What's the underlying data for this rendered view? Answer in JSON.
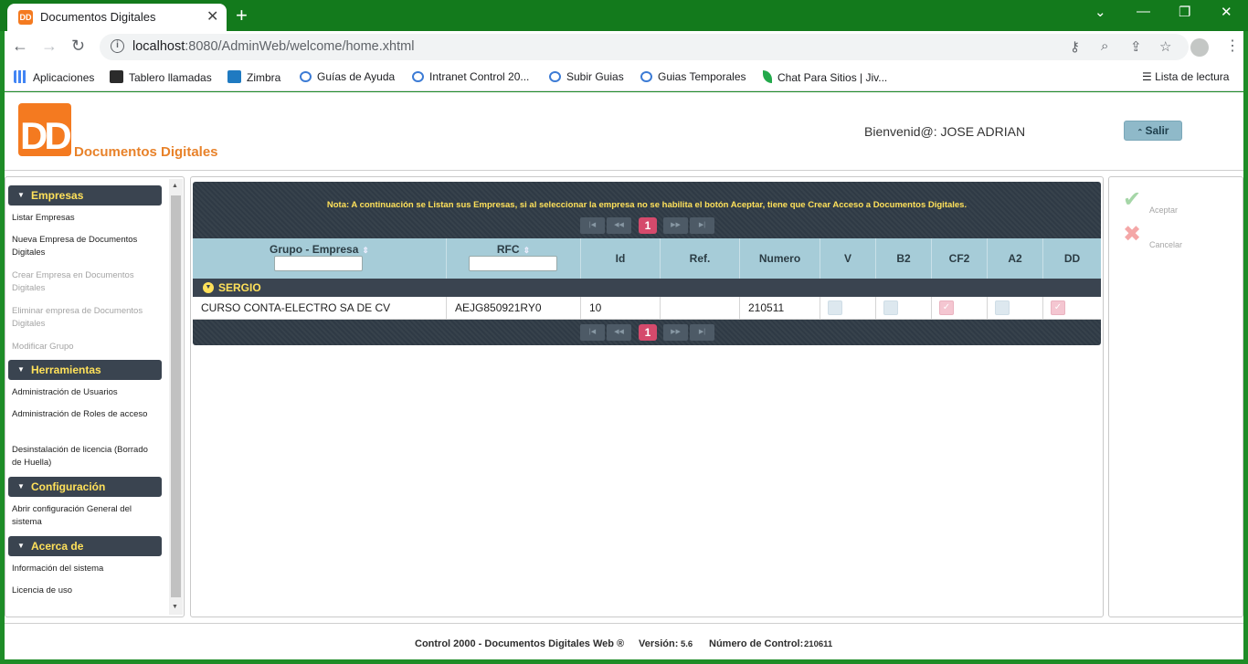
{
  "browser": {
    "tab_title": "Documentos Digitales",
    "tab_favicon": "DD",
    "url_host": "localhost",
    "url_path": ":8080/AdminWeb/welcome/home.xhtml",
    "bookmarks": [
      {
        "label": "Aplicaciones",
        "icon": "apps-grid-icon",
        "color": "#4285f4"
      },
      {
        "label": "Tablero llamadas",
        "icon": "phone-board-icon",
        "color": "#2b2b2b"
      },
      {
        "label": "Zimbra",
        "icon": "zimbra-icon",
        "color": "#1f7ac1"
      },
      {
        "label": "Guías de Ayuda",
        "icon": "co-icon",
        "color": "#3c7bd5"
      },
      {
        "label": "Intranet Control 20...",
        "icon": "co-icon",
        "color": "#3c7bd5"
      },
      {
        "label": "Subir Guias",
        "icon": "co-icon",
        "color": "#3c7bd5"
      },
      {
        "label": "Guias Temporales",
        "icon": "co-icon",
        "color": "#3c7bd5"
      },
      {
        "label": "Chat Para Sitios | Jiv...",
        "icon": "leaf-icon",
        "color": "#23a94b"
      }
    ],
    "reading_list": "Lista de lectura"
  },
  "header": {
    "logo_letters": "DD",
    "brand": "Documentos Digitales",
    "welcome": "Bienvenid@: JOSE ADRIAN",
    "logout_label": "Salir"
  },
  "sidebar": {
    "sections": [
      {
        "title": "Empresas",
        "items": [
          {
            "label": "Listar Empresas",
            "enabled": true
          },
          {
            "label": "Nueva Empresa de Documentos Digitales",
            "enabled": true
          },
          {
            "label": "Crear Empresa en Documentos Digitales",
            "enabled": false
          },
          {
            "label": "Eliminar empresa de Documentos Digitales",
            "enabled": false
          },
          {
            "label": "Modificar Grupo",
            "enabled": false
          }
        ]
      },
      {
        "title": "Herramientas",
        "items": [
          {
            "label": "Administración de Usuarios",
            "enabled": true
          },
          {
            "label": "Administración de Roles de acceso",
            "enabled": true
          },
          {
            "label": "Desinstalación de licencia (Borrado de Huella)",
            "enabled": true
          }
        ]
      },
      {
        "title": "Configuración",
        "items": [
          {
            "label": "Abrir configuración General del sistema",
            "enabled": true
          }
        ]
      },
      {
        "title": "Acerca de",
        "items": [
          {
            "label": "Información del sistema",
            "enabled": true
          },
          {
            "label": "Licencia de uso",
            "enabled": true
          }
        ]
      }
    ]
  },
  "grid": {
    "note": "Nota: A continuación se Listan sus Empresas, si al seleccionar la empresa no se habilita el botón Aceptar, tiene que Crear Acceso a Documentos Digitales.",
    "current_page": "1",
    "columns": [
      "Grupo - Empresa",
      "RFC",
      "Id",
      "Ref.",
      "Numero",
      "V",
      "B2",
      "CF2",
      "A2",
      "DD"
    ],
    "group": "SERGIO",
    "rows": [
      {
        "empresa": "CURSO CONTA-ELECTRO SA DE CV",
        "rfc": "AEJG850921RY0",
        "id": "10",
        "ref": "",
        "numero": "210511",
        "V": false,
        "B2": false,
        "CF2": true,
        "A2": false,
        "DD": true
      }
    ]
  },
  "actions": {
    "accept_label": "Aceptar",
    "cancel_label": "Cancelar"
  },
  "footer": {
    "product": "Control 2000 - Documentos Digitales Web ®",
    "version_label": "Versión:",
    "version": "5.6",
    "control_label": "Número de Control:",
    "control": "210611"
  },
  "colors": {
    "brand_orange": "#f47a20",
    "header_dark": "#2f3a45",
    "accent_yellow": "#ffe15a",
    "column_blue": "#a6ccd8",
    "page_pink": "#d54a6c",
    "accept_green": "#a5d6a7",
    "cancel_red": "#f4a7a7"
  }
}
